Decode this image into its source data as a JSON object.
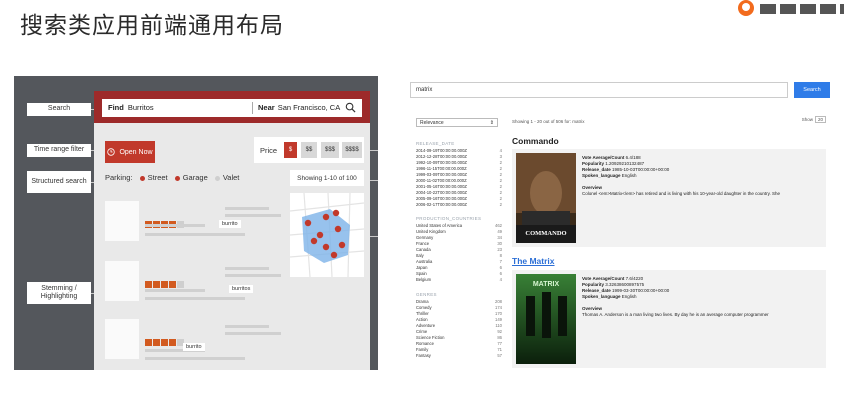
{
  "slide": {
    "title": "搜索类应用前端通用布局"
  },
  "left_mockup": {
    "callouts": {
      "search": "Search",
      "time_range_filter": "Time range filter",
      "structured_search": "Structured search",
      "stemming_highlighting": "Stemming / Highlighting"
    },
    "search": {
      "find_label": "Find",
      "find_value": "Burritos",
      "near_label": "Near",
      "near_value": "San Francisco, CA"
    },
    "open_now_label": "Open Now",
    "price": {
      "label": "Price",
      "options": [
        "$",
        "$$",
        "$$$",
        "$$$$"
      ],
      "selected": "$"
    },
    "parking": {
      "label": "Parking:",
      "options": [
        {
          "label": "Street",
          "selected": true
        },
        {
          "label": "Garage",
          "selected": true
        },
        {
          "label": "Valet",
          "selected": false
        }
      ]
    },
    "showing_label": "Showing 1-10 of 100",
    "results": [
      {
        "highlight": "burrito",
        "rating": 4
      },
      {
        "highlight": "burritos",
        "rating": 4
      },
      {
        "highlight": "burrito",
        "rating": 4
      }
    ],
    "colors": {
      "accent": "#c1392b",
      "topbar": "#9d2a2a",
      "panel_bg": "#54575c"
    }
  },
  "right_app": {
    "query": "matrix",
    "search_button": "Search",
    "sort": {
      "selected": "Relevance"
    },
    "showing_text": "Showing 1 - 20 out of 506 for: matrix",
    "per_page": {
      "label": "Show",
      "value": "20"
    },
    "facets": [
      {
        "heading": "RELEASE_DATE",
        "items": [
          {
            "label": "2014-09-19T00:00:00.000Z",
            "count": "4"
          },
          {
            "label": "2012-12-28T00:00:00.000Z",
            "count": "3"
          },
          {
            "label": "1992-10-09T00:00:00.000Z",
            "count": "2"
          },
          {
            "label": "1996-11-15T00:00:00.000Z",
            "count": "2"
          },
          {
            "label": "1999-03-09T00:00:00.000Z",
            "count": "2"
          },
          {
            "label": "2000-11-02T00:00:00.000Z",
            "count": "2"
          },
          {
            "label": "2001-05-16T00:00:00.000Z",
            "count": "2"
          },
          {
            "label": "2004-10-22T00:00:00.000Z",
            "count": "2"
          },
          {
            "label": "2005-09-16T00:00:00.000Z",
            "count": "2"
          },
          {
            "label": "2006-02-17T00:00:00.000Z",
            "count": "2"
          }
        ]
      },
      {
        "heading": "PRODUCTION_COUNTRIES",
        "items": [
          {
            "label": "United States of America",
            "count": "462"
          },
          {
            "label": "United Kingdom",
            "count": "49"
          },
          {
            "label": "Germany",
            "count": "34"
          },
          {
            "label": "France",
            "count": "30"
          },
          {
            "label": "Canada",
            "count": "23"
          },
          {
            "label": "Italy",
            "count": "8"
          },
          {
            "label": "Australia",
            "count": "7"
          },
          {
            "label": "Japan",
            "count": "6"
          },
          {
            "label": "Spain",
            "count": "6"
          },
          {
            "label": "Belgium",
            "count": "4"
          }
        ]
      },
      {
        "heading": "GENRES",
        "items": [
          {
            "label": "Drama",
            "count": "208"
          },
          {
            "label": "Comedy",
            "count": "174"
          },
          {
            "label": "Thriller",
            "count": "170"
          },
          {
            "label": "Action",
            "count": "149"
          },
          {
            "label": "Adventure",
            "count": "110"
          },
          {
            "label": "Crime",
            "count": "92"
          },
          {
            "label": "Science Fiction",
            "count": "86"
          },
          {
            "label": "Romance",
            "count": "77"
          },
          {
            "label": "Family",
            "count": "71"
          },
          {
            "label": "Fantasy",
            "count": "57"
          }
        ]
      }
    ],
    "movies": [
      {
        "title": "Commando",
        "linked": false,
        "poster_caption": "COMMANDO",
        "vote_label": "Vote Average/Count",
        "vote_value": "6.4/188",
        "popularity_label": "Popularity",
        "popularity_value": "1.20929210132487",
        "release_label": "Release_date",
        "release_value": "1985-10-03T00:00:00+00:00",
        "language_label": "Spoken_language",
        "language_value": "English",
        "overview_label": "Overview",
        "overview_value": "Colonel <em>Matrix</em> has retired and is living with his 10-year-old daughter in the country. She"
      },
      {
        "title": "The Matrix",
        "linked": true,
        "poster_caption": "MATRIX",
        "vote_label": "Vote Average/Count",
        "vote_value": "7.6/4220",
        "popularity_label": "Popularity",
        "popularity_value": "3.32638600897575",
        "release_label": "Release_date",
        "release_value": "1999-03-30T00:00:00+00:00",
        "language_label": "Spoken_language",
        "language_value": "English",
        "overview_label": "Overview",
        "overview_value": "Thomas A. Anderson is a man living two lives. By day he is an average computer programmer"
      }
    ],
    "colors": {
      "button": "#2f7ce8",
      "link": "#2c6fd6"
    }
  }
}
